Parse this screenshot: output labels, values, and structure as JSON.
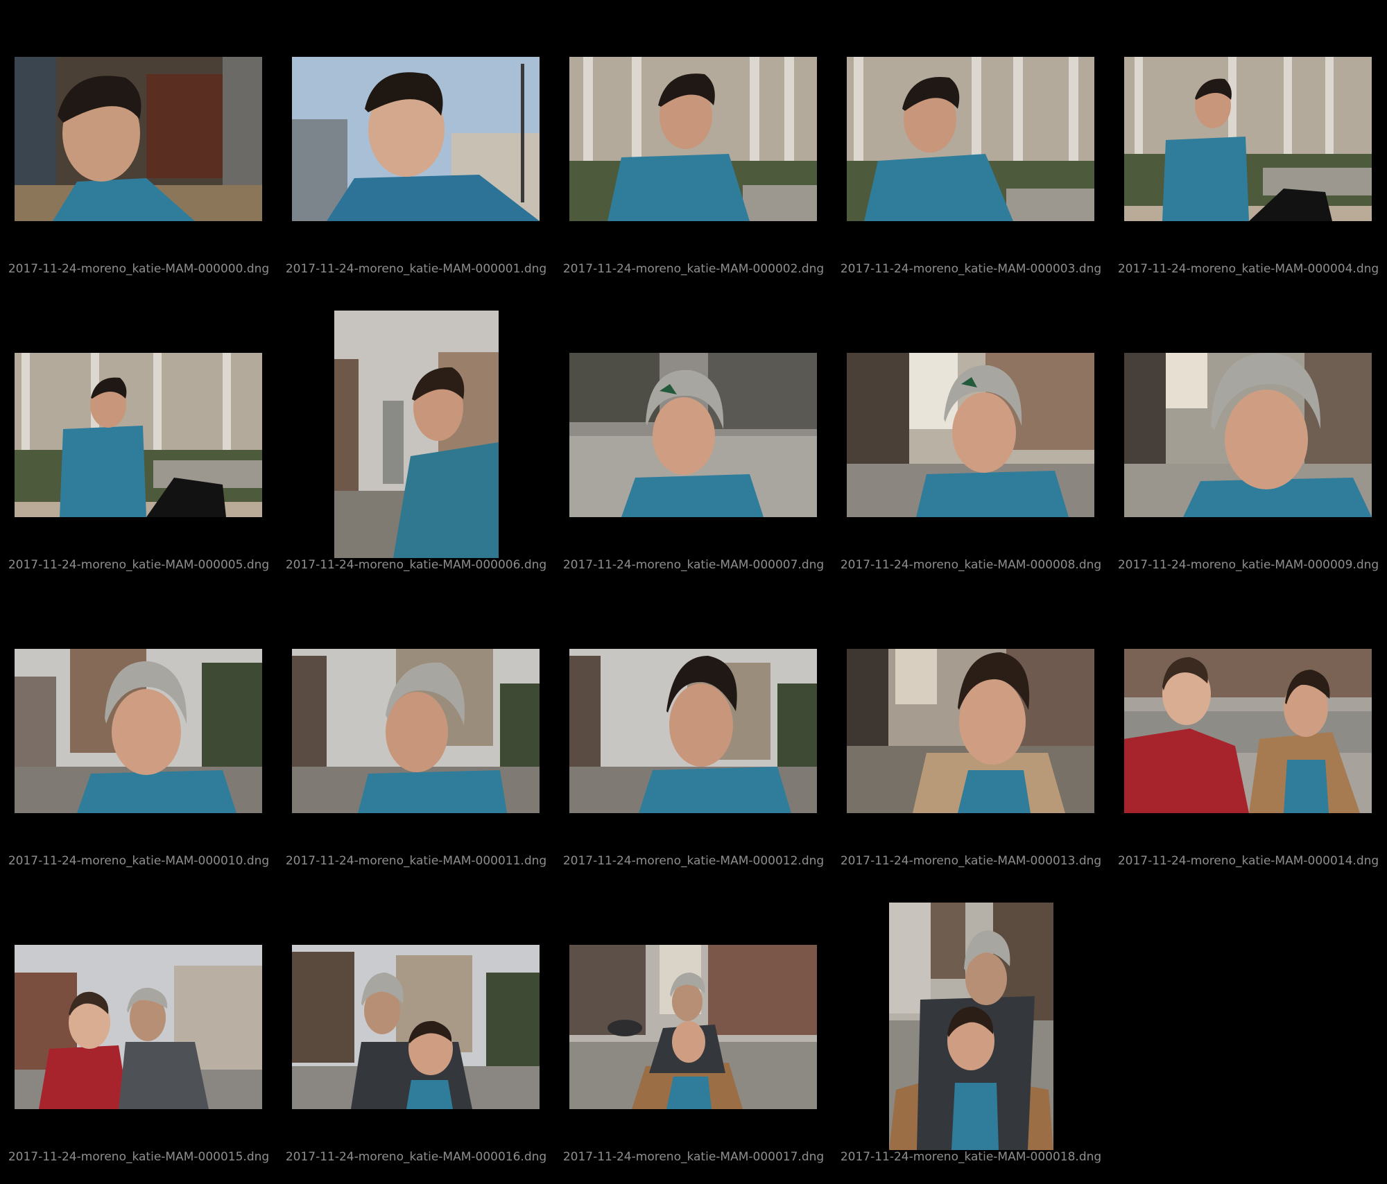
{
  "photos": [
    {
      "filename": "2017-11-24-moreno_katie-MAM-000000.dng",
      "orientation": "landscape"
    },
    {
      "filename": "2017-11-24-moreno_katie-MAM-000001.dng",
      "orientation": "landscape"
    },
    {
      "filename": "2017-11-24-moreno_katie-MAM-000002.dng",
      "orientation": "landscape"
    },
    {
      "filename": "2017-11-24-moreno_katie-MAM-000003.dng",
      "orientation": "landscape"
    },
    {
      "filename": "2017-11-24-moreno_katie-MAM-000004.dng",
      "orientation": "landscape"
    },
    {
      "filename": "2017-11-24-moreno_katie-MAM-000005.dng",
      "orientation": "landscape"
    },
    {
      "filename": "2017-11-24-moreno_katie-MAM-000006.dng",
      "orientation": "portrait"
    },
    {
      "filename": "2017-11-24-moreno_katie-MAM-000007.dng",
      "orientation": "landscape"
    },
    {
      "filename": "2017-11-24-moreno_katie-MAM-000008.dng",
      "orientation": "landscape"
    },
    {
      "filename": "2017-11-24-moreno_katie-MAM-000009.dng",
      "orientation": "landscape"
    },
    {
      "filename": "2017-11-24-moreno_katie-MAM-000010.dng",
      "orientation": "landscape"
    },
    {
      "filename": "2017-11-24-moreno_katie-MAM-000011.dng",
      "orientation": "landscape"
    },
    {
      "filename": "2017-11-24-moreno_katie-MAM-000012.dng",
      "orientation": "landscape"
    },
    {
      "filename": "2017-11-24-moreno_katie-MAM-000013.dng",
      "orientation": "landscape"
    },
    {
      "filename": "2017-11-24-moreno_katie-MAM-000014.dng",
      "orientation": "landscape"
    },
    {
      "filename": "2017-11-24-moreno_katie-MAM-000015.dng",
      "orientation": "landscape"
    },
    {
      "filename": "2017-11-24-moreno_katie-MAM-000016.dng",
      "orientation": "landscape"
    },
    {
      "filename": "2017-11-24-moreno_katie-MAM-000017.dng",
      "orientation": "landscape"
    },
    {
      "filename": "2017-11-24-moreno_katie-MAM-000018.dng",
      "orientation": "portrait"
    }
  ],
  "colors": {
    "background": "#000000",
    "caption": "#8e8e8e"
  }
}
